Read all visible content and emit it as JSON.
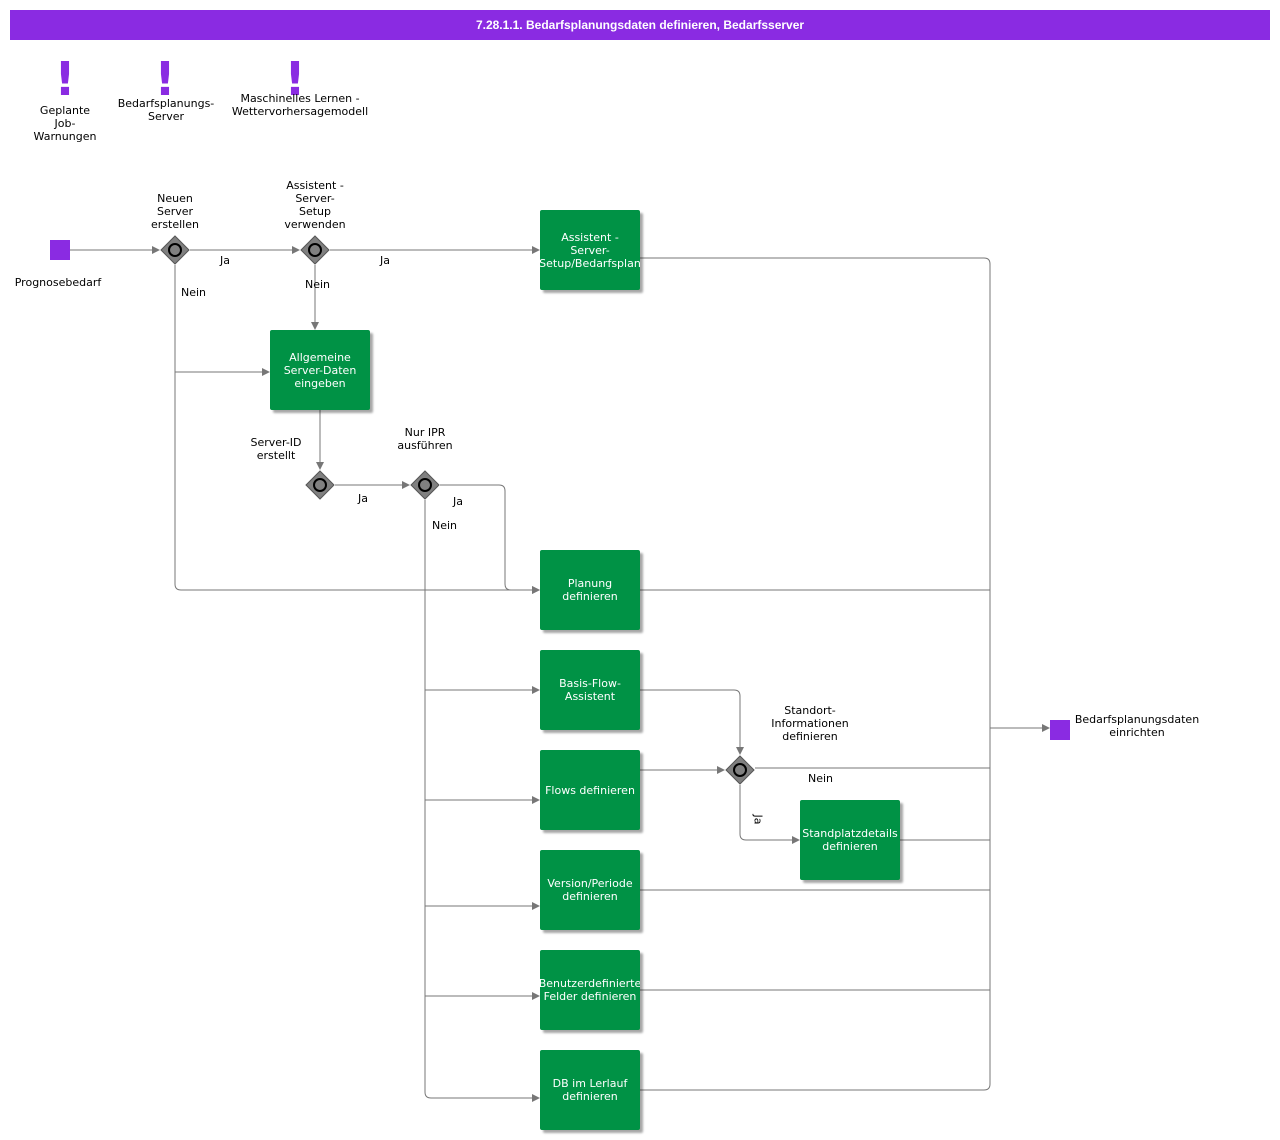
{
  "title": "7.28.1.1. Bedarfsplanungsdaten definieren, Bedarfsserver",
  "colors": {
    "accent": "#8a2be2",
    "task": "#009245",
    "gateway": "#808080",
    "line": "#777777"
  },
  "warnings": [
    {
      "label": "Geplante\nJob-\nWarnungen",
      "icon": "exclamation-icon"
    },
    {
      "label": "Bedarfsplanungs-\nServer",
      "icon": "exclamation-icon"
    },
    {
      "label": "Maschinelles Lernen -\nWettervorhersagemodell",
      "icon": "exclamation-icon"
    }
  ],
  "events": {
    "start": "Prognosebedarf",
    "end": "Bedarfsplanungsdaten\neinrichten"
  },
  "gateways": {
    "g1": "Neuen\nServer\nerstellen",
    "g2": "Assistent -\nServer-\nSetup\nverwenden",
    "g3": "Server-ID\nerstellt",
    "g4": "Nur IPR\nausführen",
    "g5": "Standort-\nInformationen\ndefinieren"
  },
  "tasks": {
    "assistent": "Assistent -\nServer-\nSetup/Bedarfsplan",
    "allgemeine": "Allgemeine\nServer-Daten\neingeben",
    "planung": "Planung\ndefinieren",
    "basisflow": "Basis-Flow-\nAssistent",
    "flows": "Flows definieren",
    "standplatz": "Standplatzdetails\ndefinieren",
    "version": "Version/Periode\ndefinieren",
    "benutzer": "Benutzerdefinierte\nFelder definieren",
    "db": "DB im Lerlauf\ndefinieren"
  },
  "flow_labels": {
    "ja": "Ja",
    "nein": "Nein"
  }
}
